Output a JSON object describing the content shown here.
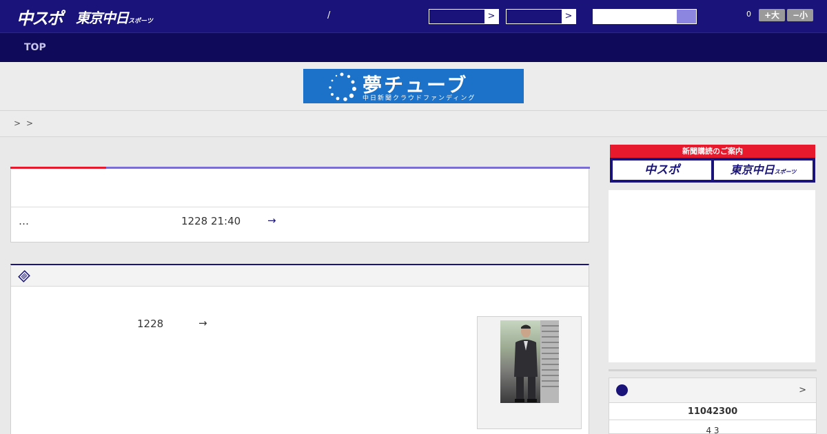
{
  "header": {
    "logo_chuspo": "中スポ",
    "logo_tokyo": "東京中日",
    "logo_tokyo_small": "スポーツ",
    "slash": "/",
    "select_arrow_1": ">",
    "select_arrow_2": ">",
    "search_placeholder": "",
    "font_count": "0",
    "font_larger": "+大",
    "font_smaller": "−小",
    "colors": {
      "bg": "#19137a",
      "accent": "#8d86e0"
    }
  },
  "nav": {
    "items": [
      {
        "label": "TOP"
      }
    ]
  },
  "banner": {
    "main": "夢チューブ",
    "sub": "中日新聞クラウドファンディング",
    "color": "#1c72c8"
  },
  "breadcrumb": {
    "sep1": ">",
    "sep2": ">"
  },
  "article1": {
    "ellipsis": "…",
    "date": "1228 21:40",
    "arrow": "→",
    "colors": {
      "bar_left": "#e6192d",
      "bar_right": "#7a6ed2"
    }
  },
  "article2": {
    "date": "1228",
    "arrow": "→",
    "photo_icon": "person-photo"
  },
  "sidebar": {
    "subscribe_title": "新聞購読のご案内",
    "subscribe_btn_1": "中スポ",
    "subscribe_btn_2": "東京中日",
    "subscribe_btn_2_small": "スポーツ",
    "score_more": ">",
    "score_row_1": "11042300",
    "score_row_2": "4  3"
  }
}
